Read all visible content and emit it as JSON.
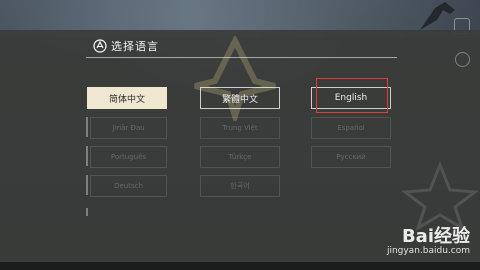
{
  "dialog": {
    "title": "选择语言"
  },
  "languages": {
    "simplified_chinese": "简体中文",
    "traditional_chinese": "繁體中文",
    "english": "English"
  },
  "faint_options": [
    "Jiriǎr Ðau",
    "Trung Việt",
    "Español",
    "Português",
    "Türkçe",
    "Русский",
    "Deutsch",
    "한국어"
  ],
  "watermark": {
    "brand": "Bai经验",
    "url": "jingyan.baidu.com"
  },
  "colors": {
    "selected_bg": "#efe7cf",
    "highlight_box": "#e03a3a"
  }
}
